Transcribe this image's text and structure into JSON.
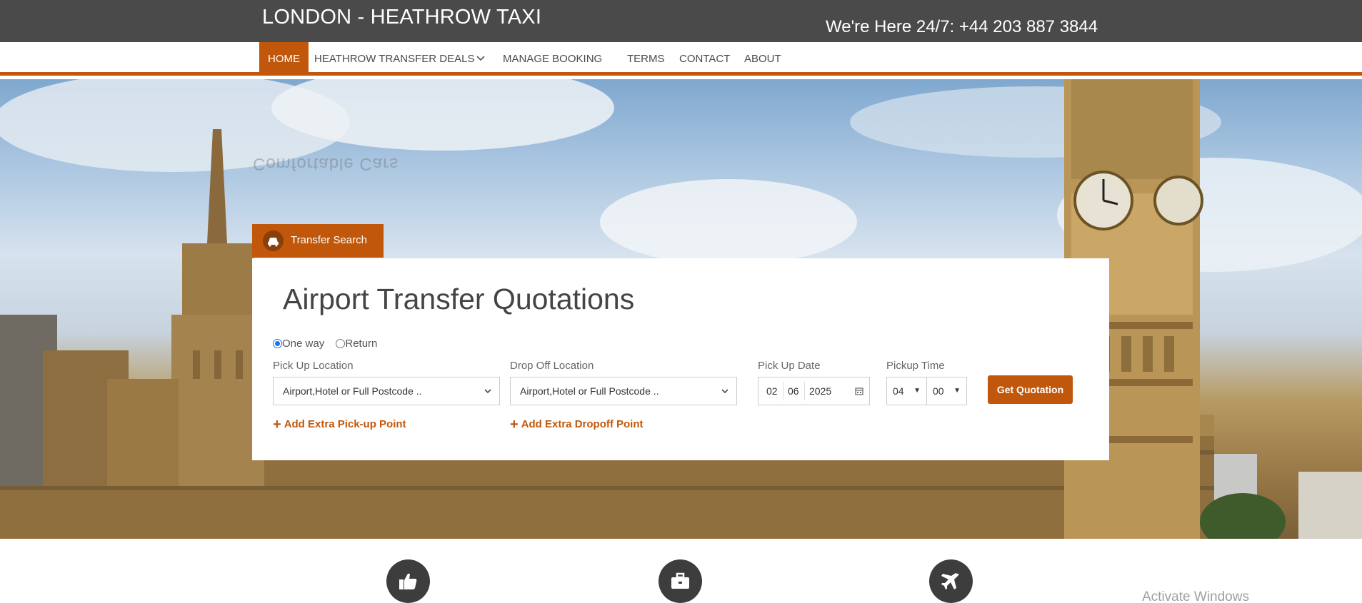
{
  "header": {
    "brand": "LONDON - HEATHROW TAXI",
    "phone": "We're Here 24/7: +44 203 887 3844"
  },
  "nav": {
    "home": "HOME",
    "deals": "HEATHROW TRANSFER DEALS",
    "manage": "MANAGE BOOKING",
    "terms": "TERMS",
    "contact": "CONTACT",
    "about": "ABOUT"
  },
  "hero": {
    "watermark": "Comfortable Cars"
  },
  "search": {
    "tab_label": "Transfer Search",
    "title": "Airport Transfer Quotations",
    "trip_type": {
      "one_way": "One way",
      "return": "Return",
      "selected": "One way"
    },
    "pickup": {
      "label": "Pick Up Location",
      "value": "Airport,Hotel or Full Postcode .."
    },
    "dropoff": {
      "label": "Drop Off Location",
      "value": "Airport,Hotel or Full Postcode .."
    },
    "date": {
      "label": "Pick Up Date",
      "day": "02",
      "month": "06",
      "year": "2025"
    },
    "time": {
      "label": "Pickup Time",
      "hour": "04",
      "minute": "00"
    },
    "submit": "Get Quotation",
    "add_pickup": "Add Extra Pick-up Point",
    "add_dropoff": "Add Extra Dropoff Point"
  },
  "features": {
    "icons": [
      "thumbs-up-icon",
      "briefcase-icon",
      "plane-icon"
    ]
  },
  "os": {
    "activation": "Activate Windows"
  },
  "colors": {
    "accent": "#c0570b",
    "topbar": "#4a4a4a"
  }
}
